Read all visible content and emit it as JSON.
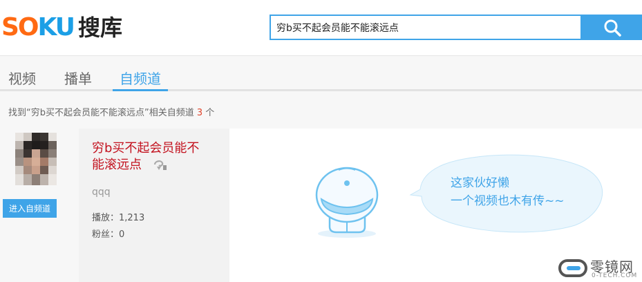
{
  "header": {
    "logo_en_part1": "SO",
    "logo_en_part2": "KU",
    "logo_cn": "搜库",
    "search_value": "穷b买不起会员能不能滚远点"
  },
  "tabs": [
    {
      "label": "视频",
      "active": false
    },
    {
      "label": "播单",
      "active": false
    },
    {
      "label": "自频道",
      "active": true
    }
  ],
  "result": {
    "prefix": "找到“穷b买不起会员能不能滚远点”相关自频道",
    "count": "3",
    "suffix": "个"
  },
  "channel": {
    "enter_button": "进入自频道",
    "title_line1": "穷b买不起会员能不",
    "title_line2": "能滚远点",
    "description": "qqq",
    "plays": "播放：1,213",
    "fans": "粉丝：0",
    "empty_line1": "这家伙好懒",
    "empty_line2": "一个视频也木有传~~"
  },
  "watermark": {
    "cn": "零镜网",
    "en": "0-TECH.COM"
  },
  "colors": {
    "brand_blue": "#3fa4e8",
    "logo_orange": "#ff6a13",
    "title_red": "#c3121f"
  }
}
